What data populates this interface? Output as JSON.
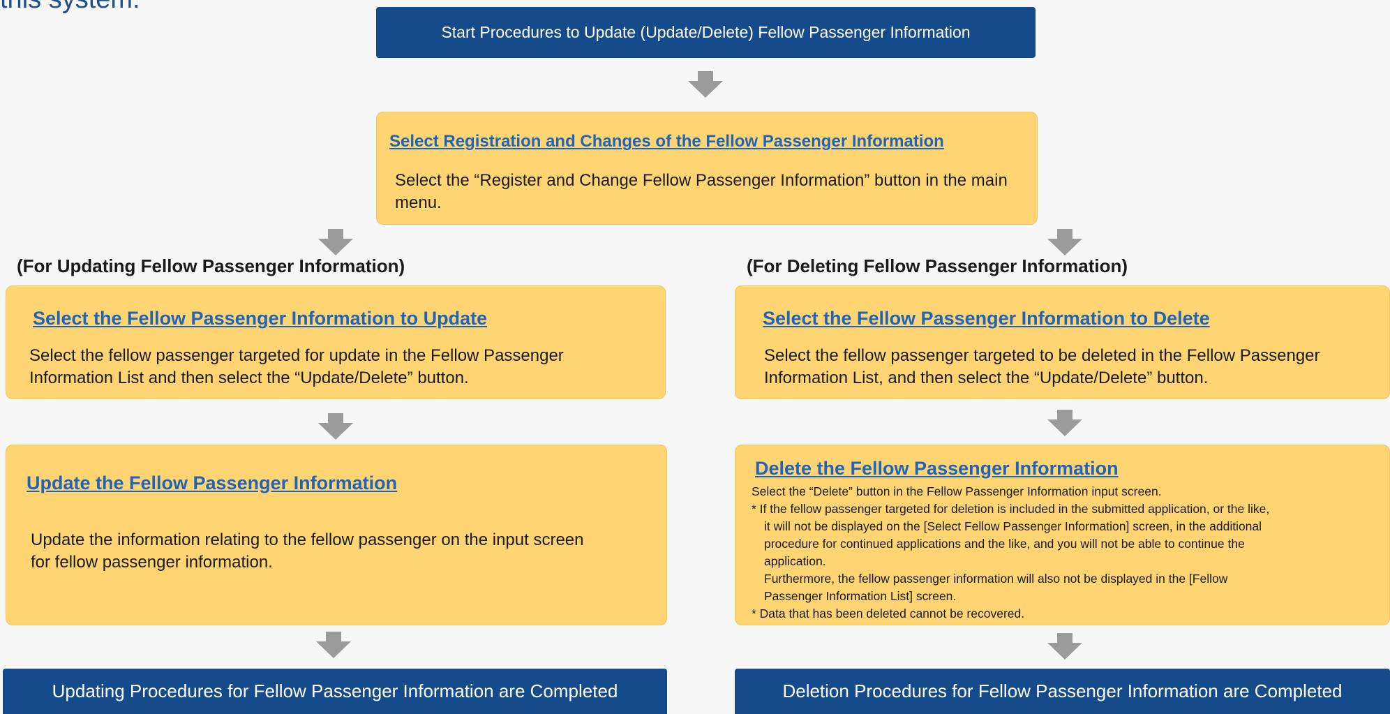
{
  "page": {
    "header_text": "this system."
  },
  "start_box": {
    "label": "Start Procedures to Update (Update/Delete) Fellow Passenger Information"
  },
  "select_registration": {
    "title": "Select Registration and Changes of the Fellow Passenger Information",
    "body": "Select the “Register and Change Fellow Passenger Information” button in the main menu."
  },
  "update_branch": {
    "section_label": "(For Updating Fellow Passenger Information)",
    "select_step": {
      "title": "Select the Fellow Passenger Information to Update",
      "body": "Select the fellow passenger targeted for update in the Fellow Passenger Information List and then select the “Update/Delete” button."
    },
    "update_step": {
      "title": "Update the Fellow Passenger Information",
      "body": "Update the information relating to the fellow passenger on the input screen for fellow passenger information."
    },
    "end_box": {
      "label": "Updating Procedures for  Fellow Passenger Information are Completed"
    }
  },
  "delete_branch": {
    "section_label": "(For Deleting Fellow Passenger Information)",
    "select_step": {
      "title": "Select the Fellow Passenger Information to Delete",
      "body": "Select the fellow passenger targeted to be deleted in the Fellow Passenger Information List, and then select the “Update/Delete” button."
    },
    "delete_step": {
      "title": "Delete the Fellow Passenger Information",
      "lines": [
        "Select the “Delete” button in the Fellow Passenger Information input screen.",
        "* If the fellow passenger targeted for deletion is included in the submitted application, or the like,",
        "it will not be displayed on the [Select Fellow Passenger Information] screen, in the additional",
        "procedure for continued applications and the like, and you will not be able to continue the",
        "application.",
        "Furthermore, the fellow passenger information will also not be displayed in the [Fellow",
        "Passenger Information List] screen.",
        "*  Data that has been deleted cannot be recovered."
      ]
    },
    "end_box": {
      "label": "Deletion Procedures for  Fellow Passenger Information are Completed"
    }
  },
  "colors": {
    "blue_box": "#154b8b",
    "yellow_box": "#ffd574",
    "title_link": "#1f64b8",
    "arrow": "#9b9b9b"
  },
  "icons": {
    "flow_arrow": "down-arrow-icon"
  }
}
